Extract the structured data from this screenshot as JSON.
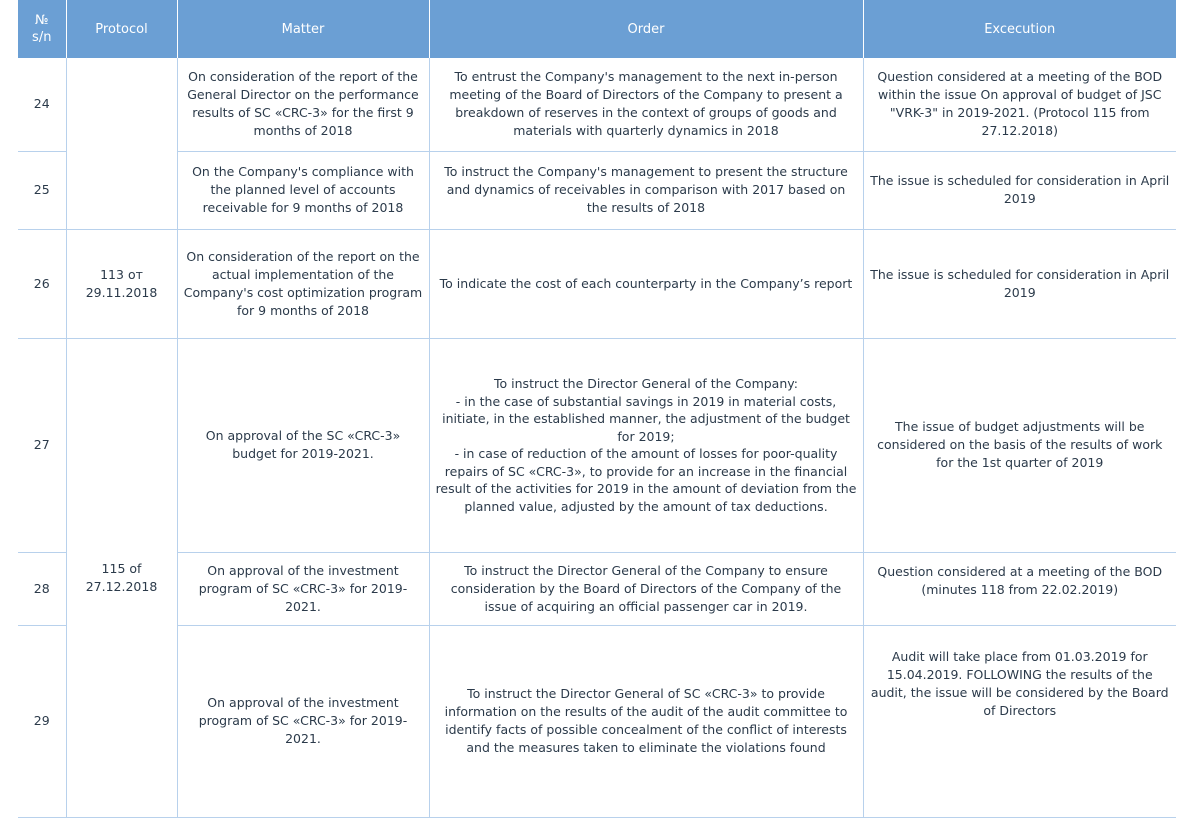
{
  "header": {
    "col_num": "№\ns/n",
    "col_protocol": "Protocol",
    "col_matter": "Matter",
    "col_order": "Order",
    "col_execution": "Excecution"
  },
  "rows": [
    {
      "num": "24",
      "matter": "On consideration of the report of the General Director on the performance results of SC «CRC-3» for the first 9 months of 2018",
      "order": "To entrust the Company's management to the next in-person meeting of the Board of Directors of the Company to present a breakdown of reserves in the context of groups of goods and materials with quarterly dynamics in 2018",
      "execution": "Question considered at a meeting of the BOD within the issue On approval of budget of JSC \"VRK-3\" in 2019-2021. (Protocol 115 from 27.12.2018)"
    },
    {
      "num": "25",
      "matter": "On the Company's compliance with the planned level of accounts receivable for 9 months of 2018",
      "order": "To instruct the Company's management to present the structure and dynamics of receivables in comparison with 2017 based on the results of 2018",
      "execution": "The issue is scheduled for consideration in April 2019"
    },
    {
      "num": "26",
      "protocol": "113 от 29.11.2018",
      "matter": "On consideration of the report on the actual implementation of the Company's cost optimization program for 9 months of 2018",
      "order": "To indicate the cost of each counterparty in the Company’s report",
      "execution": "The issue is scheduled for consideration in April 2019"
    },
    {
      "num": "27",
      "matter": "On approval of the SC «CRC-3» budget for 2019-2021.",
      "order_lines": [
        "To instruct the Director General of the Company:",
        "- in the case of substantial savings in 2019 in material costs, initiate, in the established manner, the adjustment of the budget for 2019;",
        "- in case of reduction of the amount of losses for poor-quality repairs of SC «CRC-3», to provide for an increase in the financial result of the activities for 2019 in the amount of deviation from the planned value, adjusted by the amount of tax deductions."
      ],
      "execution": "The issue of budget adjustments will be considered on the basis of the results of work for the 1st quarter of 2019"
    },
    {
      "num": "28",
      "protocol": "115 of 27.12.2018",
      "matter": "On approval of the investment program of SC «CRC-3» for 2019-2021.",
      "order": "To instruct the Director General of the Company to ensure consideration by the Board of Directors of the Company of the issue of acquiring an official passenger car in 2019.",
      "execution": "Question considered at a meeting of the BOD (minutes 118 from 22.02.2019)"
    },
    {
      "num": "29",
      "matter": "On approval of the investment program of SC «CRC-3» for 2019-2021.",
      "order": "To instruct the Director General of SC «CRC-3» to provide information on the results of the audit of the audit committee to identify facts of possible concealment of the conflict of interests and the measures taken to eliminate the violations found",
      "execution": "Audit will take place from 01.03.2019 for 15.04.2019. FOLLOWING the results of the audit, the issue will be considered by the Board of Directors"
    }
  ]
}
